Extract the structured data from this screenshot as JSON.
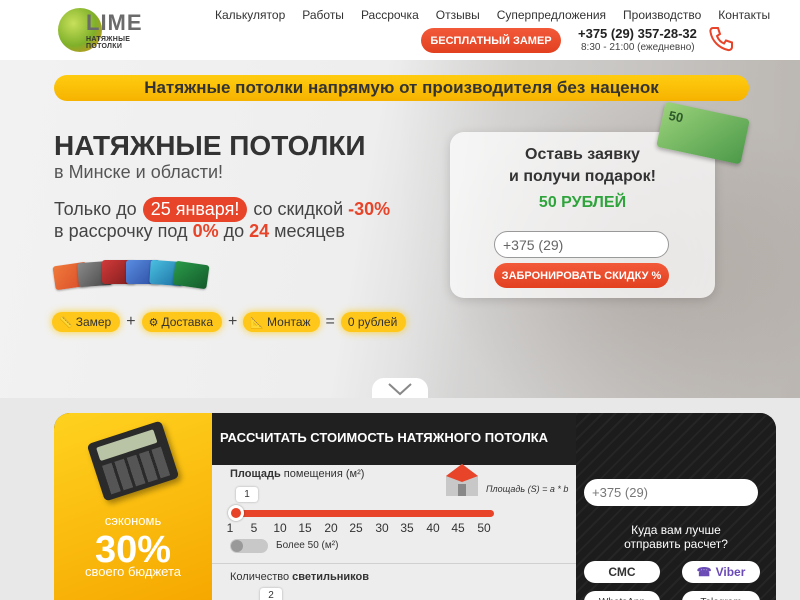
{
  "header": {
    "logo_word": "LIME",
    "logo_sub": "НАТЯЖНЫЕ ПОТОЛКИ",
    "nav": [
      "Калькулятор",
      "Работы",
      "Рассрочка",
      "Отзывы",
      "Суперпредложения",
      "Производство",
      "Контакты"
    ],
    "cta": "БЕСПЛАТНЫЙ ЗАМЕР",
    "phone": "+375 (29) 357-28-32",
    "hours": "8:30 - 21:00 (ежедневно)"
  },
  "hero": {
    "banner": "Натяжные потолки напрямую от производителя без наценок",
    "title": "НАТЯЖНЫЕ ПОТОЛКИ",
    "subtitle": "в Минске и области!",
    "offer_prefix": "Только до",
    "offer_date": "25 января!",
    "offer_mid": "со скидкой",
    "offer_discount": "-30%",
    "installment_prefix": "в рассрочку под",
    "installment_rate": "0%",
    "installment_mid": "до",
    "installment_months": "24",
    "installment_suffix": "месяцев",
    "steps": [
      {
        "label": "Замер",
        "icon": "ruler-icon"
      },
      {
        "label": "Доставка",
        "icon": "gear-icon"
      },
      {
        "label": "Монтаж",
        "icon": "angle-icon"
      }
    ],
    "step_ops": [
      "+",
      "+",
      "="
    ],
    "total": "0 рублей",
    "form": {
      "title_line1": "Оставь заявку",
      "title_line2": "и получи подарок!",
      "gift": "50 РУБЛЕЙ",
      "phone_placeholder": "+375 (29)",
      "button": "ЗАБРОНИРОВАТЬ СКИДКУ %"
    },
    "money_label": "50"
  },
  "calculator": {
    "save_line1": "сэкономь",
    "save_value": "30%",
    "save_line3": "своего бюджета",
    "heading": "РАССЧИТАТЬ СТОИМОСТЬ НАТЯЖНОГО ПОТОЛКА",
    "area_label_bold": "Площадь",
    "area_label_rest": " помещения (м²)",
    "formula": "Площадь (S) = a * b",
    "area_value": "1",
    "scale": [
      "1",
      "5",
      "10",
      "15",
      "20",
      "25",
      "30",
      "35",
      "40",
      "45",
      "50"
    ],
    "toggle_label": "Более 50 (м²)",
    "lamps_label_prefix": "Количество ",
    "lamps_label_bold": "светильников",
    "lamps_value": "2",
    "right": {
      "phone_placeholder": "+375 (29)",
      "question_line1": "Куда вам лучше",
      "question_line2": "отправить расчет?",
      "sms": "СМС",
      "viber": "Viber",
      "whatsapp": "WhatsApp",
      "telegram": "Telegram"
    }
  },
  "colors": {
    "accent_red": "#e8442a",
    "accent_yellow": "#ffc71a",
    "green": "#2fa43c"
  }
}
